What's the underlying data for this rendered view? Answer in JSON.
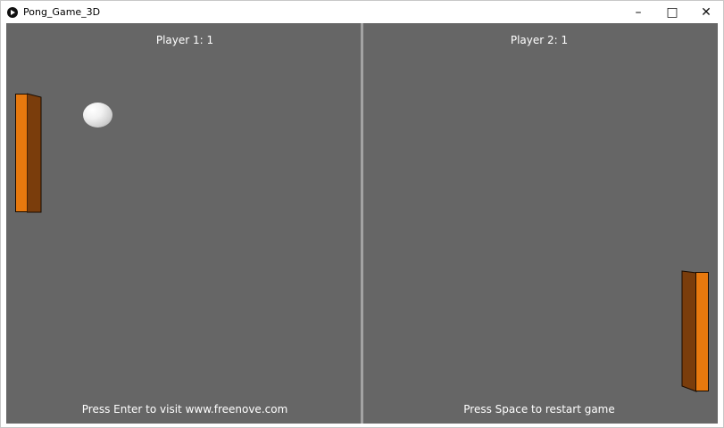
{
  "window": {
    "title": "Pong_Game_3D",
    "controls": {
      "minimize": "–",
      "maximize": "□",
      "close": "✕"
    }
  },
  "game": {
    "score_left": "Player 1: 1",
    "score_right": "Player 2: 1",
    "hint_left": "Press Enter to visit www.freenove.com",
    "hint_right": "Press Space to restart game"
  },
  "colors": {
    "background": "#666666",
    "divider": "#a3a3a3",
    "paddle_front": "#e8790e",
    "paddle_side": "#7a3d0c",
    "text": "#ffffff"
  }
}
